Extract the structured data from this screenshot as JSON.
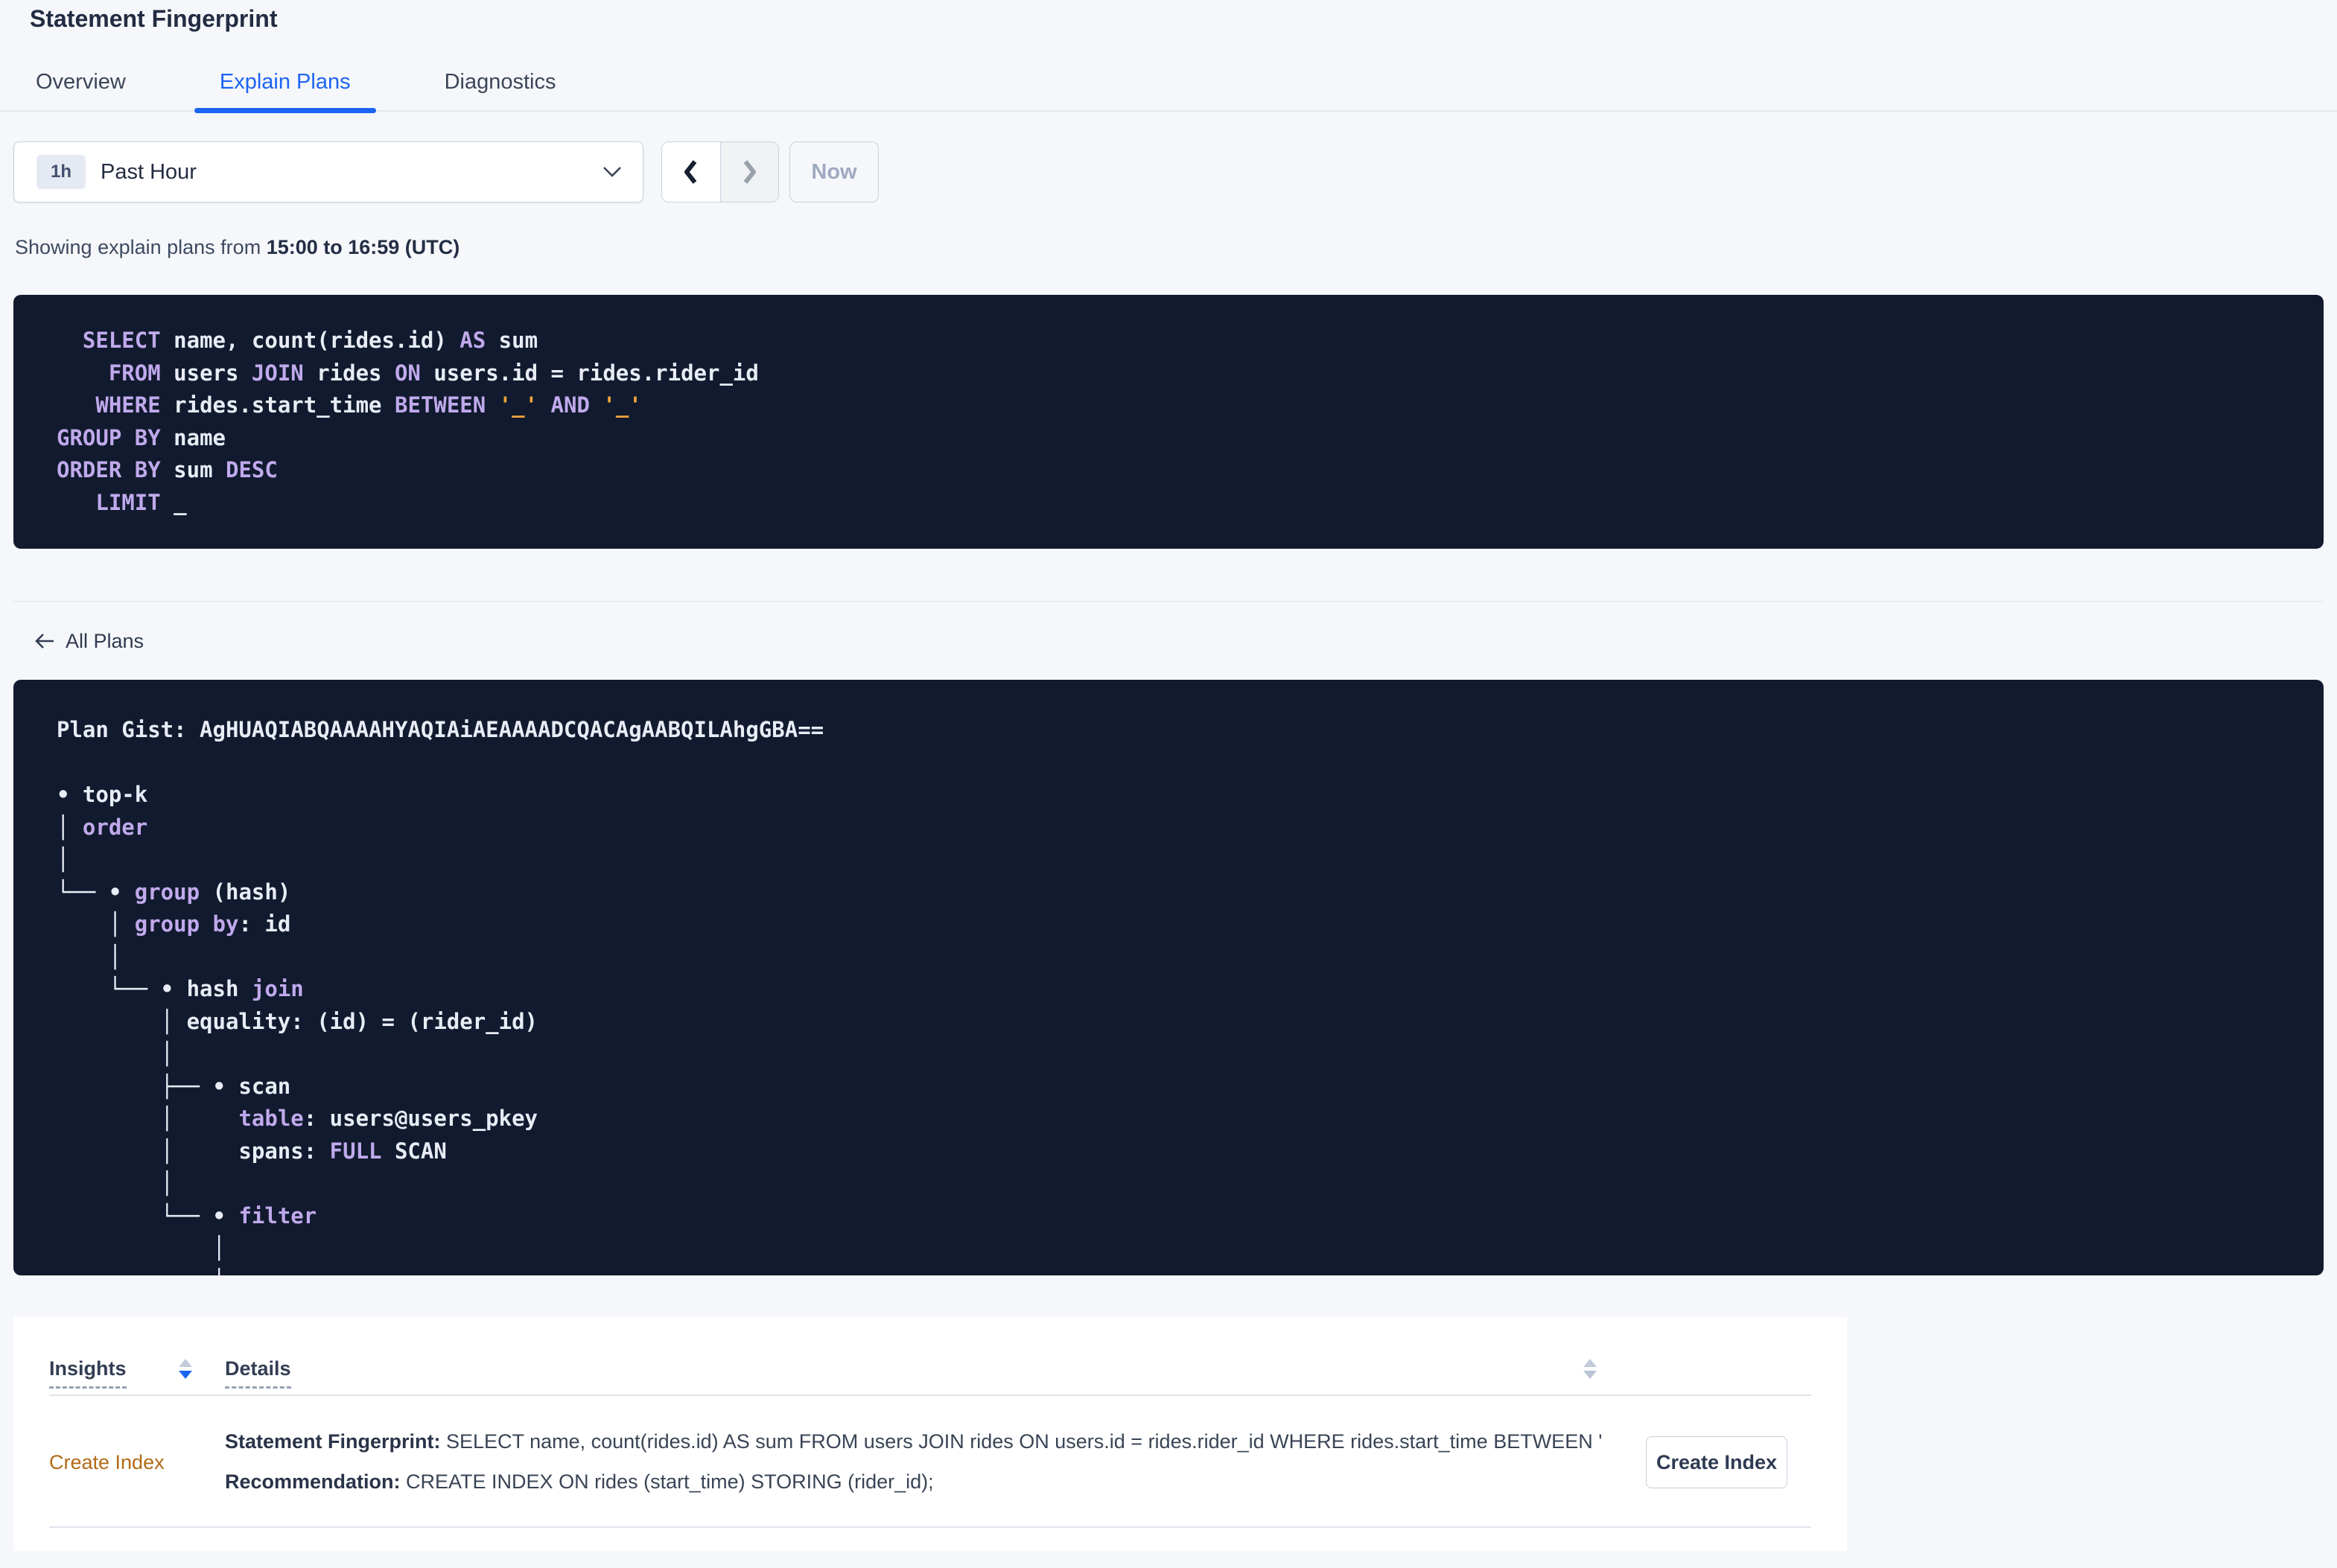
{
  "page": {
    "title": "Statement Fingerprint"
  },
  "tabs": [
    {
      "label": "Overview",
      "active": false
    },
    {
      "label": "Explain Plans",
      "active": true
    },
    {
      "label": "Diagnostics",
      "active": false
    }
  ],
  "time_selector": {
    "badge": "1h",
    "label": "Past Hour",
    "now_label": "Now"
  },
  "showing": {
    "prefix": "Showing explain plans from ",
    "range": "15:00 to 16:59 (UTC)"
  },
  "sql": {
    "lines": [
      [
        [
          "p",
          "  "
        ],
        [
          "k",
          "SELECT"
        ],
        [
          "p",
          " name, count(rides.id) "
        ],
        [
          "k",
          "AS"
        ],
        [
          "p",
          " sum"
        ]
      ],
      [
        [
          "p",
          "    "
        ],
        [
          "k",
          "FROM"
        ],
        [
          "p",
          " users "
        ],
        [
          "k",
          "JOIN"
        ],
        [
          "p",
          " rides "
        ],
        [
          "k",
          "ON"
        ],
        [
          "p",
          " users.id = rides.rider_id"
        ]
      ],
      [
        [
          "p",
          "   "
        ],
        [
          "k",
          "WHERE"
        ],
        [
          "p",
          " rides.start_time "
        ],
        [
          "k",
          "BETWEEN"
        ],
        [
          "p",
          " "
        ],
        [
          "l",
          "'_'"
        ],
        [
          "p",
          " "
        ],
        [
          "k",
          "AND"
        ],
        [
          "p",
          " "
        ],
        [
          "l",
          "'_'"
        ]
      ],
      [
        [
          "k",
          "GROUP BY"
        ],
        [
          "p",
          " name"
        ]
      ],
      [
        [
          "k",
          "ORDER BY"
        ],
        [
          "p",
          " sum "
        ],
        [
          "k",
          "DESC"
        ]
      ],
      [
        [
          "p",
          "   "
        ],
        [
          "k",
          "LIMIT"
        ],
        [
          "p",
          " _"
        ]
      ]
    ]
  },
  "nav_back": {
    "label": "All Plans"
  },
  "plan": {
    "gist": "AgHUAQIABQAAAAHYAQIAiAEAAAADCQACAgAABQILAhgGBA==",
    "lines": [
      [
        [
          "p",
          "Plan Gist: AgHUAQIABQAAAAHYAQIAiAEAAAADCQACAgAABQILAhgGBA=="
        ]
      ],
      [
        [
          "p",
          ""
        ]
      ],
      [
        [
          "p",
          "• top-k"
        ]
      ],
      [
        [
          "p",
          "│ "
        ],
        [
          "k",
          "order"
        ]
      ],
      [
        [
          "p",
          "│"
        ]
      ],
      [
        [
          "p",
          "└── • "
        ],
        [
          "k",
          "group"
        ],
        [
          "p",
          " (hash)"
        ]
      ],
      [
        [
          "p",
          "    │ "
        ],
        [
          "k",
          "group by"
        ],
        [
          "p",
          ": id"
        ]
      ],
      [
        [
          "p",
          "    │"
        ]
      ],
      [
        [
          "p",
          "    └── • hash "
        ],
        [
          "k",
          "join"
        ]
      ],
      [
        [
          "p",
          "        │ equality: (id) = (rider_id)"
        ]
      ],
      [
        [
          "p",
          "        │"
        ]
      ],
      [
        [
          "p",
          "        ├── • scan"
        ]
      ],
      [
        [
          "p",
          "        │     "
        ],
        [
          "k",
          "table"
        ],
        [
          "p",
          ": users@users_pkey"
        ]
      ],
      [
        [
          "p",
          "        │     spans: "
        ],
        [
          "k",
          "FULL"
        ],
        [
          "p",
          " SCAN"
        ]
      ],
      [
        [
          "p",
          "        │"
        ]
      ],
      [
        [
          "p",
          "        └── • "
        ],
        [
          "k",
          "filter"
        ]
      ],
      [
        [
          "p",
          "            │"
        ]
      ],
      [
        [
          "p",
          "            │"
        ]
      ]
    ]
  },
  "insights_table": {
    "col_insights": "Insights",
    "col_details": "Details",
    "row": {
      "insight": "Create Index",
      "fingerprint_label": "Statement Fingerprint:",
      "fingerprint_text": " SELECT name, count(rides.id) AS sum FROM users JOIN rides ON users.id = rides.rider_id WHERE rides.start_time BETWEEN '_…",
      "recommendation_label": "Recommendation:",
      "recommendation_text": " CREATE INDEX ON rides (start_time) STORING (rider_id);",
      "action_label": "Create Index"
    }
  },
  "colors": {
    "accent": "#1c64f2",
    "code_bg": "#111a2e",
    "keyword": "#c0a9ec",
    "code_text": "#e8ecf5",
    "literal": "#f0a43c",
    "insight": "#b36a16"
  }
}
